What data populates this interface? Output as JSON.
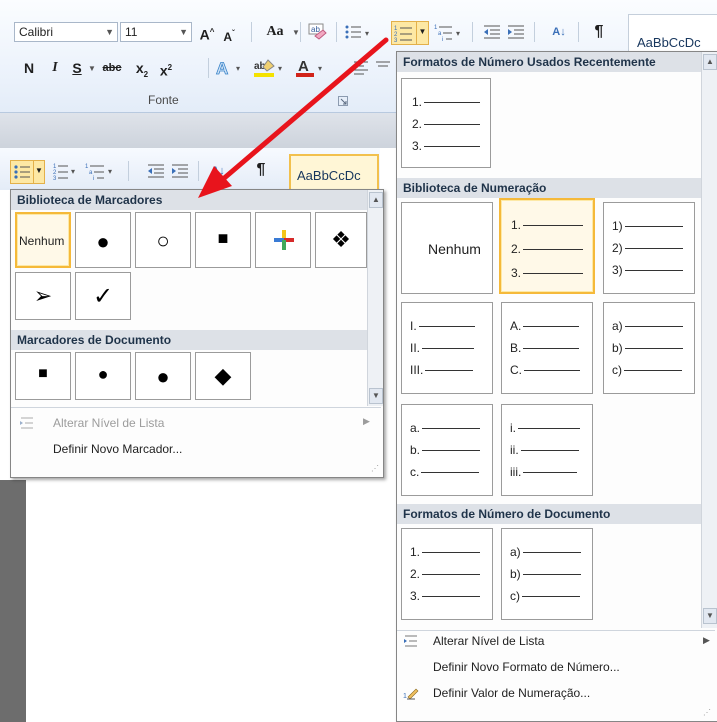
{
  "ribbon": {
    "font_name": "Calibri",
    "font_size": "11",
    "group_label": "Fonte",
    "style_preview": "AaBbCcDc",
    "icons": [
      "grow-font-icon",
      "shrink-font-icon",
      "change-case-icon",
      "clear-format-icon",
      "bullets-icon",
      "numbering-icon",
      "multilevel-icon",
      "decrease-indent-icon",
      "increase-indent-icon",
      "sort-icon",
      "pilcrow-icon",
      "bold-icon",
      "italic-icon",
      "strikethrough-icon",
      "subscript-icon",
      "superscript-icon",
      "text-effects-icon",
      "highlight-icon",
      "font-color-icon",
      "align-icon"
    ],
    "buttons": {
      "grow": "A",
      "shrink": "A",
      "case": "Aa",
      "bold": "N",
      "italic": "I",
      "underline": "S",
      "strike": "abc",
      "sub": "x",
      "sup": "x",
      "pilcrow": "¶",
      "sort": "A↓"
    }
  },
  "small_toolbar": {
    "style_preview": "AaBbCcDc",
    "pilcrow": "¶"
  },
  "bullet_menu": {
    "library_header": "Biblioteca de Marcadores",
    "none_label": "Nenhum",
    "library_glyphs": [
      "●",
      "○",
      "■",
      "✚",
      "❖",
      "➢",
      "✓"
    ],
    "document_header": "Marcadores de Documento",
    "document_glyphs": [
      "■",
      "●",
      "●",
      "◆"
    ],
    "change_level": "Alterar Nível de Lista",
    "define_new": "Definir Novo Marcador...",
    "change_level_disabled": true
  },
  "number_menu": {
    "recent_header": "Formatos de Número Usados Recentemente",
    "recent": [
      [
        "1.",
        "2.",
        "3."
      ]
    ],
    "library_header": "Biblioteca de Numeração",
    "none_label": "Nenhum",
    "library": [
      [
        "1.",
        "2.",
        "3."
      ],
      [
        "1)",
        "2)",
        "3)"
      ],
      [
        "I.",
        "II.",
        "III."
      ],
      [
        "A.",
        "B.",
        "C."
      ],
      [
        "a)",
        "b)",
        "c)"
      ],
      [
        "a.",
        "b.",
        "c."
      ],
      [
        "i.",
        "ii.",
        "iii."
      ]
    ],
    "document_header": "Formatos de Número de Documento",
    "document": [
      [
        "1.",
        "2.",
        "3."
      ],
      [
        "a)",
        "b)",
        "c)"
      ]
    ],
    "change_level": "Alterar Nível de Lista",
    "define_new_format": "Definir Novo Formato de Número...",
    "set_value": "Definir Valor de Numeração..."
  },
  "colors": {
    "annotation_arrow": "#e8141c",
    "selection": "#f5b93a",
    "header_bg": "#dde1e7"
  }
}
